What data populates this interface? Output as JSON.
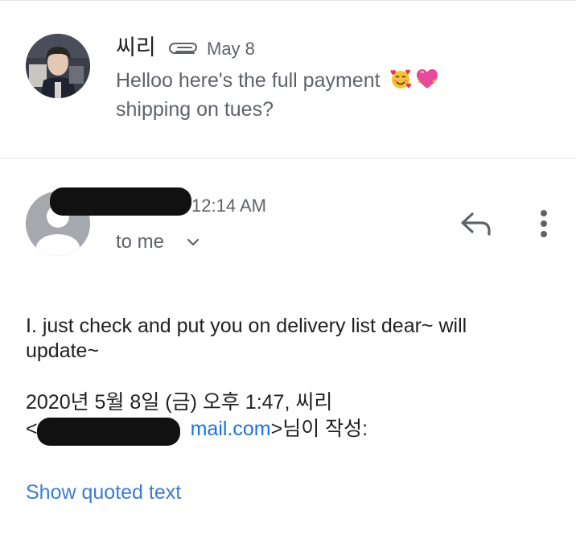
{
  "thread": {
    "message1": {
      "sender": "씨리",
      "attachment_icon": "paperclip-icon",
      "date": "May 8",
      "snippet": "Helloo here's the full payment",
      "snippet_line2": "shipping on tues?",
      "emojis": [
        "smiling-face-with-hearts",
        "sparkling-heart"
      ]
    },
    "message2": {
      "time": "12:14 AM",
      "recipient": "to me",
      "body": "I. just check and put you on delivery list dear~ will update~",
      "quote_header_line1": "2020년 5월 8일 (금) 오후 1:47, 씨리",
      "quote_lt": "<",
      "quote_email_visible": "mail.com",
      "quote_suffix": ">님이 작성:",
      "show_quoted": "Show quoted text",
      "actions": {
        "reply_icon": "reply-icon",
        "more_icon": "more-vert-icon"
      }
    }
  },
  "colors": {
    "primary_text": "#202124",
    "secondary_text": "#5f6368",
    "link": "#1a73e8",
    "show_quoted": "#3c7ecf",
    "avatar_placeholder": "#a5a9ad",
    "redaction": "#111111"
  }
}
